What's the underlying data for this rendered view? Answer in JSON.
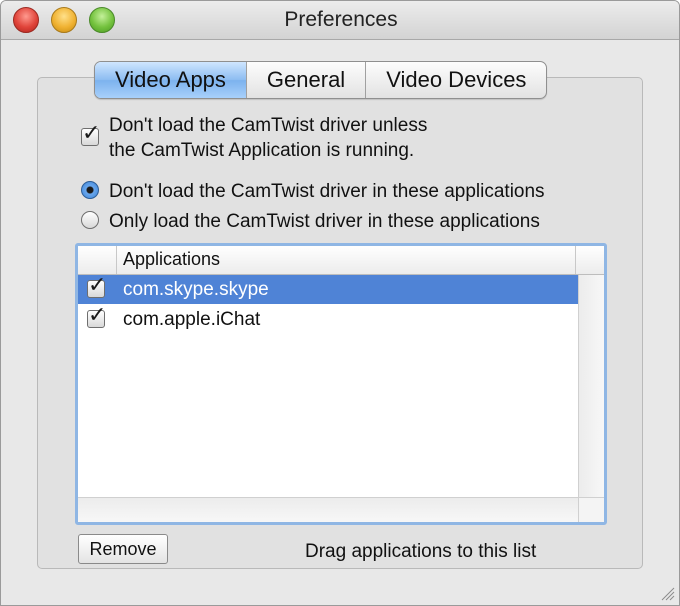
{
  "window": {
    "title": "Preferences"
  },
  "tabs": [
    {
      "label": "Video Apps",
      "active": true
    },
    {
      "label": "General",
      "active": false
    },
    {
      "label": "Video Devices",
      "active": false
    }
  ],
  "driver_checkbox": {
    "checked": true,
    "line1": "Don't load the CamTwist driver unless",
    "line2": "the CamTwist Application is running."
  },
  "load_mode": {
    "options": [
      {
        "label": "Don't load the CamTwist driver in these applications",
        "selected": true
      },
      {
        "label": "Only load the CamTwist driver in these applications",
        "selected": false
      }
    ]
  },
  "applications_table": {
    "header": "Applications",
    "rows": [
      {
        "name": "com.skype.skype",
        "checked": true,
        "selected": true
      },
      {
        "name": "com.apple.iChat",
        "checked": true,
        "selected": false
      }
    ]
  },
  "remove_button": {
    "label": "Remove"
  },
  "drag_hint": "Drag applications to this list",
  "colors": {
    "selection": "#4f83d6",
    "active_tab": "#8cbcf1",
    "focus_ring": "#8fb6e4"
  }
}
